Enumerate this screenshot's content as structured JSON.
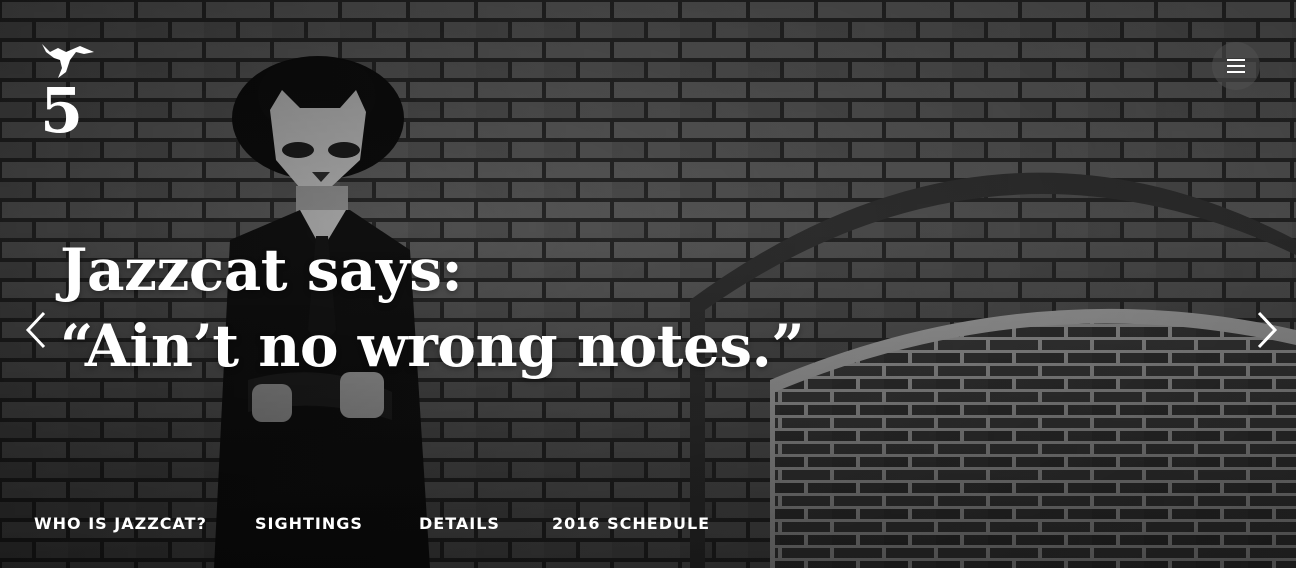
{
  "logo": {
    "number": "5",
    "icon": "jazzcat-figure-icon"
  },
  "menu": {
    "icon": "hamburger-menu-icon"
  },
  "hero": {
    "line1": "Jazzcat says:",
    "line2": "“Ain’t no wrong notes.”"
  },
  "carousel": {
    "prev_icon": "chevron-left-icon",
    "next_icon": "chevron-right-icon"
  },
  "nav": {
    "items": [
      {
        "label": "WHO IS JAZZCAT?"
      },
      {
        "label": "SIGHTINGS"
      },
      {
        "label": "DETAILS"
      },
      {
        "label": "2016 SCHEDULE"
      }
    ]
  },
  "colors": {
    "text": "#ffffff",
    "overlay": "#000000"
  }
}
